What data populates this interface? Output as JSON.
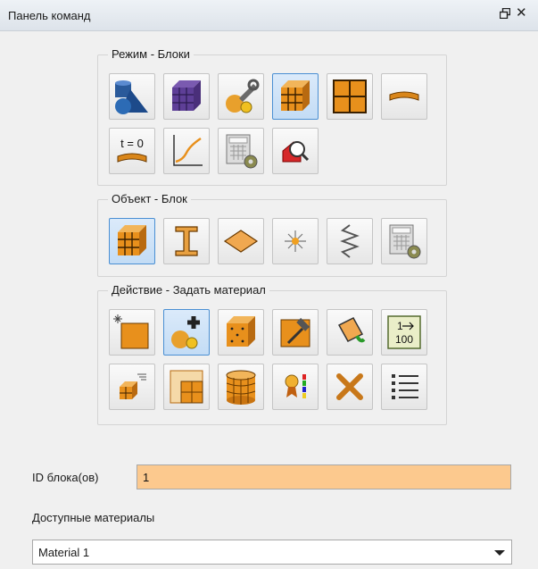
{
  "panel": {
    "title": "Панель команд"
  },
  "groups": {
    "mode": {
      "label": "Режим - Блоки"
    },
    "object": {
      "label": "Объект - Блок"
    },
    "action": {
      "label": "Действие - Задать материал"
    }
  },
  "icons": {
    "mode": [
      "geometry-icon",
      "mesh-icon",
      "tools-icon",
      "blocks-icon",
      "grid-frame-icon",
      "curved-plate-icon",
      "time-zero-icon",
      "xy-plot-icon",
      "calculator-gear-icon",
      "zoom-inspect-icon"
    ],
    "object": [
      "block-cube-icon",
      "ibeam-icon",
      "surface-icon",
      "point-star-icon",
      "spring-icon",
      "calculator-gear-icon"
    ],
    "action": [
      "create-block-icon",
      "add-material-icon",
      "dotted-cube-icon",
      "hammer-icon",
      "paint-bucket-icon",
      "numbering-icon",
      "stacked-cubes-icon",
      "split-grid-icon",
      "cylinder-icon",
      "medal-color-icon",
      "delete-icon",
      "list-icon"
    ]
  },
  "icon_texts": {
    "time_zero": "t = 0",
    "numbering_top": "1",
    "numbering_bottom": "100"
  },
  "fields": {
    "block_id": {
      "label": "ID блока(ов)",
      "value": "1"
    },
    "materials": {
      "label": "Доступные материалы",
      "selected": "Material 1"
    }
  },
  "colors": {
    "active_border": "#4a8fd3",
    "input_highlight": "#fcc98e",
    "cube_orange": "#e8901c"
  }
}
